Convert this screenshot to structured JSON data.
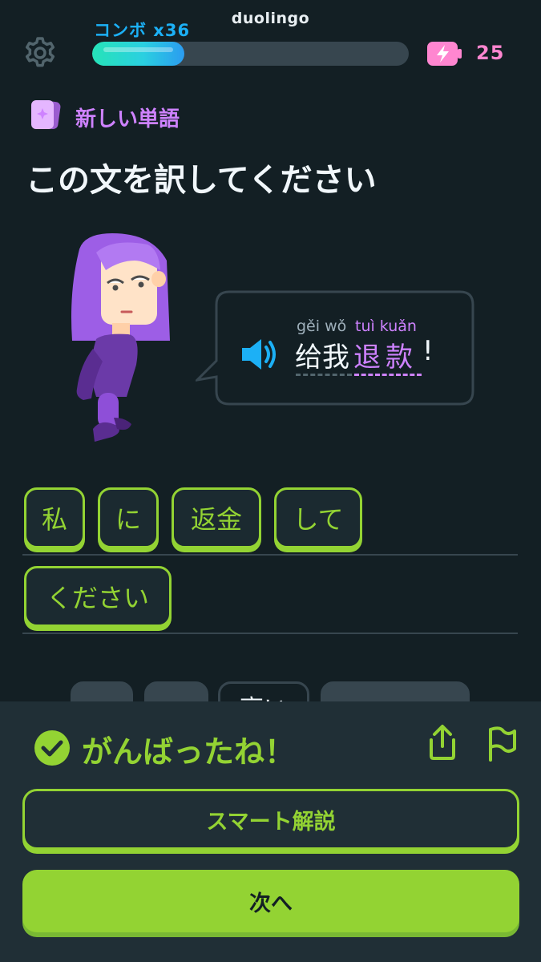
{
  "header": {
    "watermark": "duolingo",
    "combo": "コンボ x36",
    "progress": 0.29,
    "energy": "25"
  },
  "badge": {
    "label": "新しい単語"
  },
  "prompt": {
    "title": "この文を訳してください"
  },
  "sentence": {
    "pinyin_normal": "gěi wǒ",
    "pinyin_highlight": "tuì kuǎn",
    "hanzi_normal": "给我",
    "hanzi_highlight": "退款",
    "hanzi_end": "!"
  },
  "answer_tiles": [
    "私",
    "に",
    "返金",
    "して",
    "ください"
  ],
  "word_bank": {
    "visible_tile": "高い"
  },
  "feedback": {
    "message": "がんばったね！",
    "explain_button": "スマート解説",
    "next_button": "次へ"
  },
  "colors": {
    "background": "#131f24",
    "green": "#93d333",
    "purple": "#ce82ff",
    "blue": "#1cb0f6",
    "energy_pink": "#ff86d0"
  },
  "icons": [
    "gear-icon",
    "energy-icon",
    "new-word-icon",
    "speaker-icon",
    "check-icon",
    "share-icon",
    "flag-icon"
  ]
}
